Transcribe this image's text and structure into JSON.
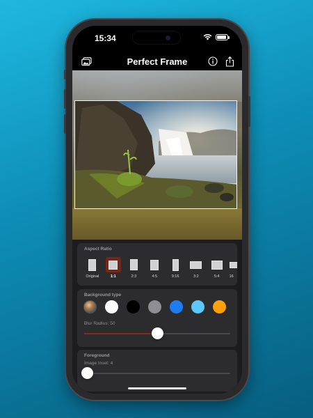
{
  "status_bar": {
    "time": "15:34",
    "battery_level": 0.9
  },
  "navbar": {
    "title": "Perfect Frame",
    "left_icon": "photo-library-icon",
    "right_icons": [
      "info-icon",
      "share-icon"
    ]
  },
  "aspect_ratio": {
    "title": "Aspect Ratio",
    "selected": "1:1",
    "options": [
      {
        "label": "Original"
      },
      {
        "label": "1:1"
      },
      {
        "label": "2:3"
      },
      {
        "label": "4:5"
      },
      {
        "label": "9:16"
      },
      {
        "label": "3:2"
      },
      {
        "label": "5:4"
      },
      {
        "label": "16"
      }
    ]
  },
  "background_type": {
    "title": "Background type",
    "options": [
      {
        "name": "image-blur",
        "color": "gradient"
      },
      {
        "name": "white",
        "color": "#ffffff"
      },
      {
        "name": "black",
        "color": "#000000"
      },
      {
        "name": "gray",
        "color": "#8e8e93"
      },
      {
        "name": "blue",
        "color": "#1e7cf2"
      },
      {
        "name": "light-blue",
        "color": "#5ac8fa"
      },
      {
        "name": "orange",
        "color": "#ff9f0a"
      }
    ],
    "blur_label": "Blur Radius: 50",
    "blur_value": 50,
    "blur_max": 100
  },
  "foreground": {
    "title": "Foreground",
    "inset_label": "Image Inset: 4",
    "inset_value": 4,
    "inset_max": 200
  },
  "colors": {
    "accent": "#8a2a1c",
    "selected_ratio": "#7a2418"
  }
}
